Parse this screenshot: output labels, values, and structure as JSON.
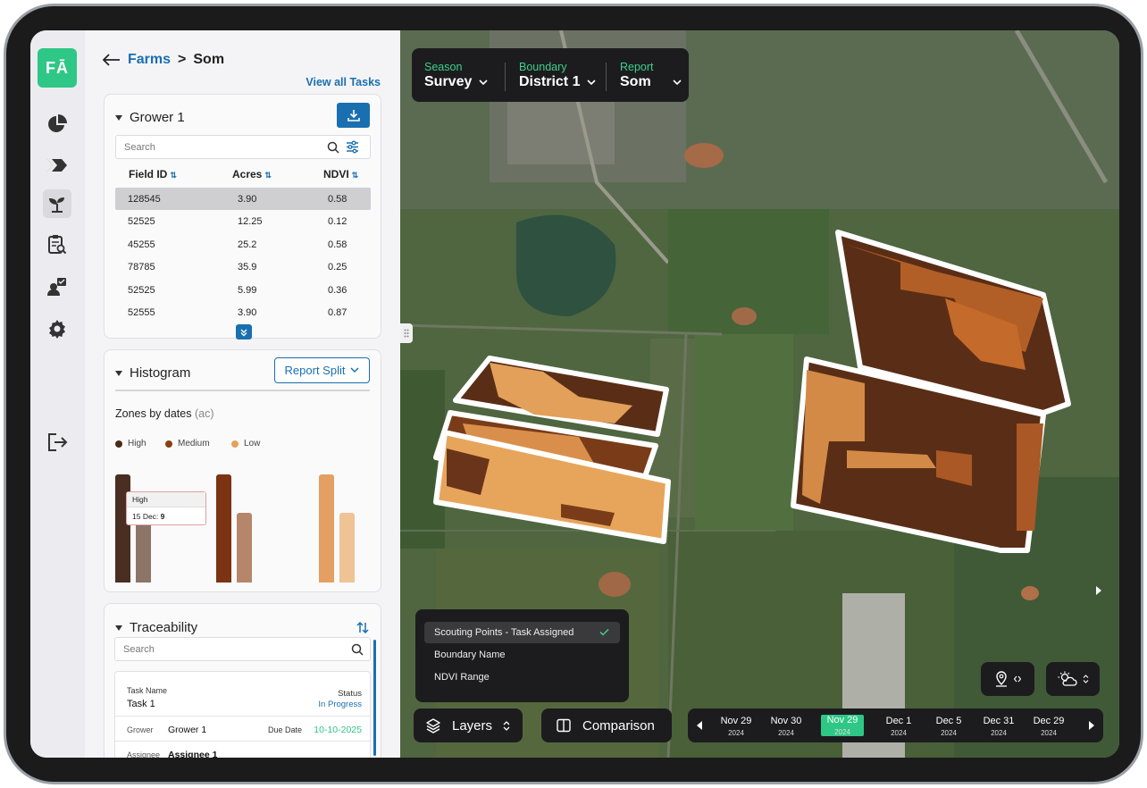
{
  "app": {
    "logo_text": "FĀ",
    "accent": "#2ec786",
    "link_color": "#1a6fb0"
  },
  "rail": {
    "icons": [
      "pie-chart-icon",
      "layers-icon",
      "seedling-icon",
      "clipboard-search-icon",
      "user-check-icon",
      "gear-icon",
      "logout-icon"
    ]
  },
  "breadcrumb": {
    "parent": "Farms",
    "separator": ">",
    "current": "Som"
  },
  "view_all": "View all Tasks",
  "grower": {
    "title": "Grower 1",
    "search_placeholder": "Search",
    "columns": [
      "Field ID",
      "Acres",
      "NDVI"
    ],
    "rows": [
      {
        "id": "128545",
        "acres": "3.90",
        "ndvi": "0.58"
      },
      {
        "id": "52525",
        "acres": "12.25",
        "ndvi": "0.12"
      },
      {
        "id": "45255",
        "acres": "25.2",
        "ndvi": "0.58"
      },
      {
        "id": "78785",
        "acres": "35.9",
        "ndvi": "0.25"
      },
      {
        "id": "52525",
        "acres": "5.99",
        "ndvi": "0.36"
      },
      {
        "id": "52555",
        "acres": "3.90",
        "ndvi": "0.87"
      }
    ]
  },
  "histogram": {
    "title": "Histogram",
    "report_split": "Report Split",
    "zones_label": "Zones by dates",
    "zones_unit": "(ac)",
    "legend": [
      {
        "name": "High",
        "color": "#4a2a1a"
      },
      {
        "name": "Medium",
        "color": "#8a3f12"
      },
      {
        "name": "Low",
        "color": "#e6a15a"
      }
    ],
    "tooltip_title": "High",
    "tooltip_label": "15 Dec:",
    "tooltip_value": "9"
  },
  "chart_data": {
    "type": "bar",
    "categories": [
      "High",
      "Medium",
      "Low"
    ],
    "series": [
      {
        "values": [
          9,
          9,
          9
        ]
      },
      {
        "values": [
          6.5,
          5.8,
          5.8
        ]
      }
    ],
    "colors": [
      [
        "#4a2e22",
        "#8c7468"
      ],
      [
        "#7b3312",
        "#b5866a"
      ],
      [
        "#e3a062",
        "#efc393"
      ]
    ],
    "ylim": [
      0,
      10
    ]
  },
  "traceability": {
    "title": "Traceability",
    "search_placeholder": "Search",
    "task_name_label": "Task Name",
    "task_name": "Task 1",
    "status_label": "Status",
    "status": "In Progress",
    "grower_label": "Grower",
    "grower": "Grower 1",
    "due_label": "Due Date",
    "due": "10-10-2025",
    "assignee_label": "Assignee",
    "assignee": "Assignee 1"
  },
  "map": {
    "season_label": "Season",
    "season": "Survey",
    "boundary_label": "Boundary",
    "boundary": "District 1",
    "report_label": "Report",
    "report": "Som",
    "menu": [
      "Scouting Points - Task Assigned",
      "Boundary Name",
      "NDVI Range"
    ],
    "layers": "Layers",
    "comparison": "Comparison",
    "dates": [
      {
        "d": "Nov 29",
        "y": "2024"
      },
      {
        "d": "Nov 30",
        "y": "2024"
      },
      {
        "d": "Nov 29",
        "y": "2024",
        "active": true
      },
      {
        "d": "Dec 1",
        "y": "2024"
      },
      {
        "d": "Dec 5",
        "y": "2024"
      },
      {
        "d": "Dec 31",
        "y": "2024"
      },
      {
        "d": "Dec 29",
        "y": "2024"
      }
    ]
  }
}
